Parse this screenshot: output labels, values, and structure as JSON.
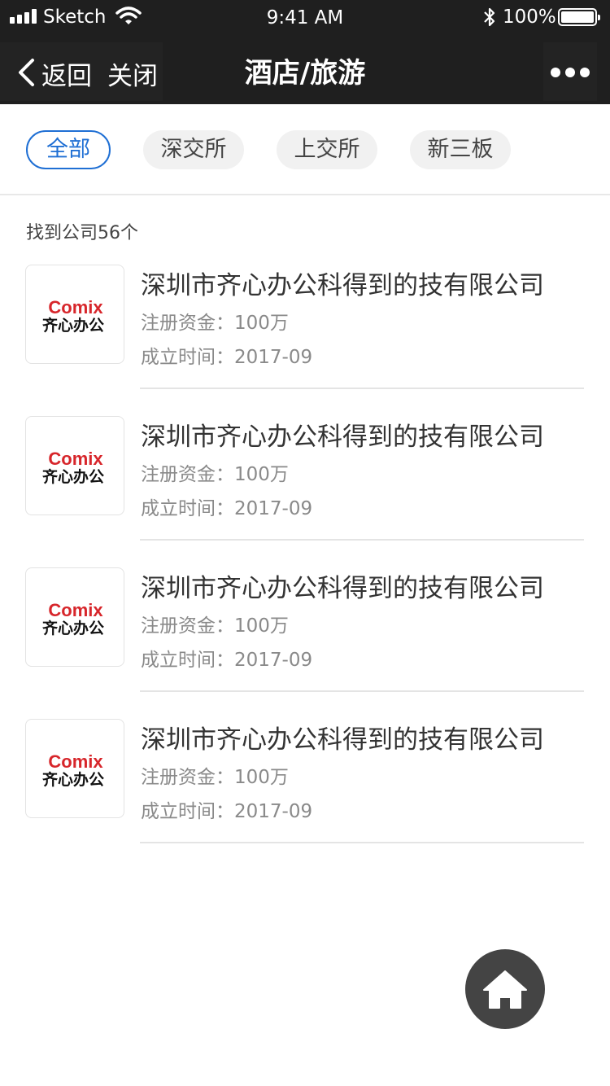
{
  "status_bar": {
    "carrier": "Sketch",
    "time": "9:41 AM",
    "battery": "100%"
  },
  "nav": {
    "back_label": "返回",
    "close_label": "关闭",
    "title": "酒店/旅游",
    "more_icon": "more-dots-icon"
  },
  "filters": {
    "tabs": [
      {
        "label": "全部",
        "active": true
      },
      {
        "label": "深交所",
        "active": false
      },
      {
        "label": "上交所",
        "active": false
      },
      {
        "label": "新三板",
        "active": false
      }
    ]
  },
  "result_count": "找到公司56个",
  "companies": [
    {
      "logo_top": "Comix",
      "logo_bottom": "齐心办公",
      "name": "深圳市齐心办公科得到的技有限公司",
      "capital": "注册资金：100万",
      "founded": "成立时间：2017-09"
    },
    {
      "logo_top": "Comix",
      "logo_bottom": "齐心办公",
      "name": "深圳市齐心办公科得到的技有限公司",
      "capital": "注册资金：100万",
      "founded": "成立时间：2017-09"
    },
    {
      "logo_top": "Comix",
      "logo_bottom": "齐心办公",
      "name": "深圳市齐心办公科得到的技有限公司",
      "capital": "注册资金：100万",
      "founded": "成立时间：2017-09"
    },
    {
      "logo_top": "Comix",
      "logo_bottom": "齐心办公",
      "name": "深圳市齐心办公科得到的技有限公司",
      "capital": "注册资金：100万",
      "founded": "成立时间：2017-09"
    }
  ],
  "colors": {
    "nav_bg": "#1f1f1f",
    "accent": "#1f6fd4",
    "logo_red": "#d7262b",
    "home_bg": "#444444"
  },
  "icons": {
    "home": "home-icon"
  }
}
